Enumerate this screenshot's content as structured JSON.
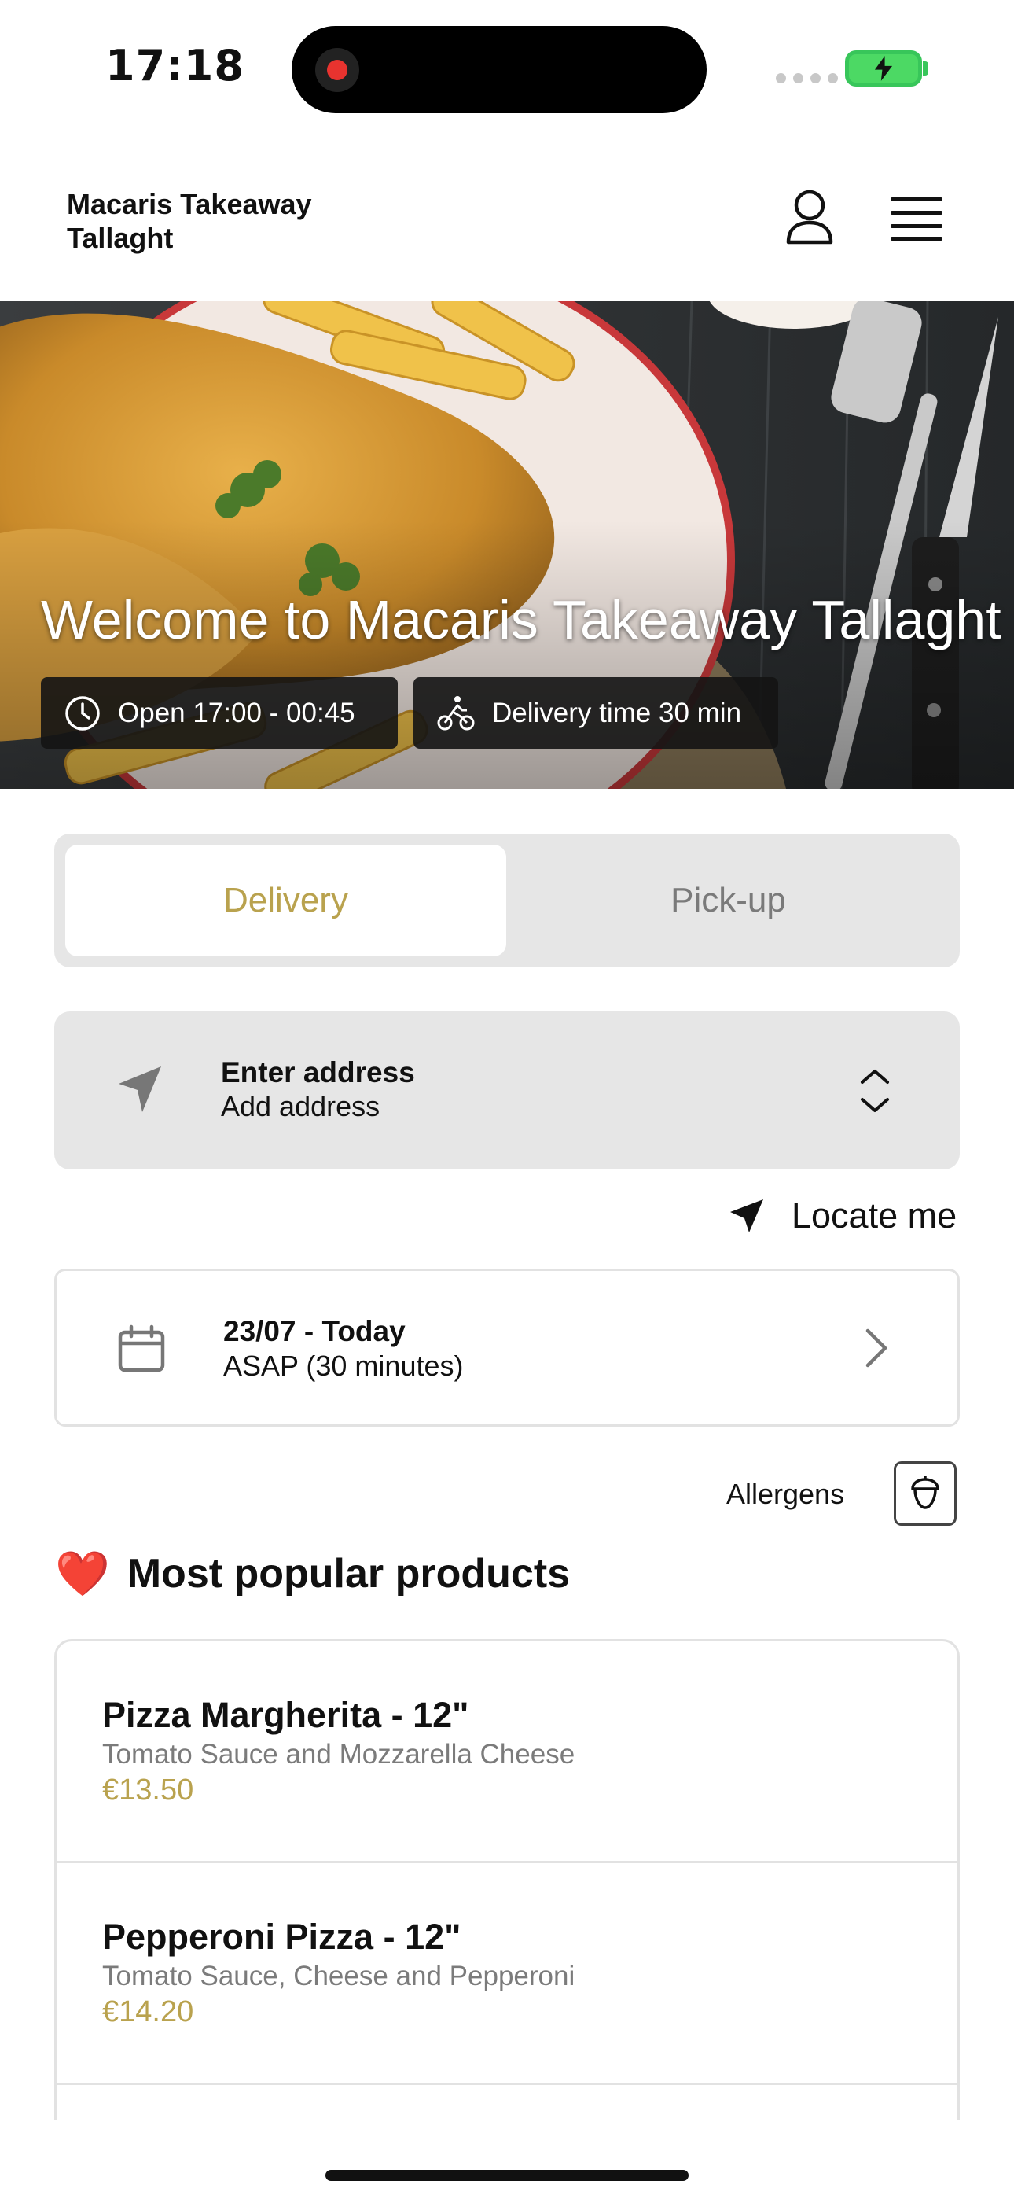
{
  "status_bar": {
    "time": "17:18"
  },
  "header": {
    "restaurant_name": "Macaris Takeaway Tallaght"
  },
  "hero": {
    "title": "Welcome to Macaris Takeaway Tallaght",
    "open_hours": "Open 17:00 - 00:45",
    "delivery_time": "Delivery time 30 min"
  },
  "order_mode": {
    "options": [
      {
        "label": "Delivery",
        "selected": true
      },
      {
        "label": "Pick-up",
        "selected": false
      }
    ],
    "accent_color": "#b9a24e"
  },
  "address": {
    "title": "Enter address",
    "subtitle": "Add address",
    "locate_label": "Locate me"
  },
  "schedule": {
    "date": "23/07 - Today",
    "time": "ASAP (30 minutes)"
  },
  "allergens": {
    "label": "Allergens"
  },
  "popular": {
    "emoji": "❤️",
    "title": "Most popular products",
    "products": [
      {
        "name": "Pizza Margherita - 12\"",
        "description": "Tomato Sauce and Mozzarella Cheese",
        "price": "€13.50"
      },
      {
        "name": "Pepperoni Pizza - 12\"",
        "description": "Tomato Sauce, Cheese and Pepperoni",
        "price": "€14.20"
      }
    ]
  }
}
